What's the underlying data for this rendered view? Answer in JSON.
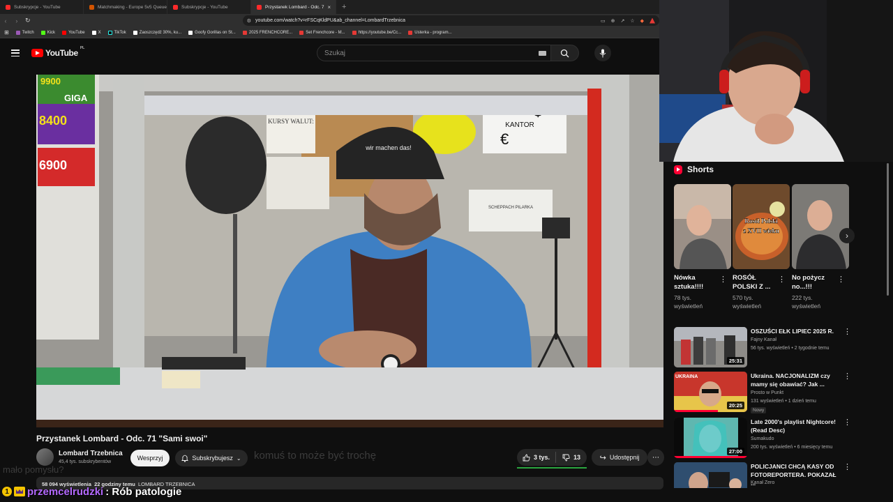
{
  "browser": {
    "tabs": [
      {
        "label": "Subskrypcje - YouTube",
        "active": false
      },
      {
        "label": "Matchmaking - Europe 5v5 Queue",
        "active": false
      },
      {
        "label": "Subskrypcje - YouTube",
        "active": false
      },
      {
        "label": "Przystanek Lombard - Odc. 7",
        "active": true
      }
    ],
    "url": "youtube.com/watch?v=rFSCqKldPU&ab_channel=LombardTrzebnica",
    "bookmarks": [
      "Twitch",
      "Kick",
      "YouTube",
      "X",
      "TikTok",
      "Zaoszczędź 30%, ku...",
      "Goofy Gorillas on St...",
      "2025 FRENCHCORE...",
      "Set Frenchcore - M...",
      "https://youtube.be/Cc...",
      "Usterka - program..."
    ]
  },
  "masthead": {
    "logo_text": "YouTube",
    "region": "PL",
    "search_placeholder": "Szukaj"
  },
  "video": {
    "title": "Przystanek Lombard - Odc. 71 \"Sami swoi\"",
    "channel_name": "Lombard Trzebnica",
    "channel_subs": "45,4 tys. subskrybentów",
    "support_label": "Wesprzyj",
    "subscribed_label": "Subskrybujesz",
    "likes": "3 tys.",
    "dislikes": "13",
    "share_label": "Udostępnij",
    "more_label": "⋯",
    "views": "58 094 wyświetlenia",
    "posted": "22 godziny temu",
    "channel_caps": "LOMBARD TRZEBNICA",
    "overlay_ghost_1": "komuś to może być trochę",
    "overlay_ghost_2": "mało pomysłu?"
  },
  "shorts": {
    "heading": "Shorts",
    "items": [
      {
        "title": "Nówka sztuka!!!!",
        "views": "78 tys. wyświetleń"
      },
      {
        "title": "ROSÓŁ POLSKI Z ...",
        "views": "570 tys. wyświetleń",
        "thumb_text_1": "Rosół Polski",
        "thumb_text_2": "z XVII wieku"
      },
      {
        "title": "No pożycz no...!!!",
        "views": "222 tys. wyświetleń"
      }
    ]
  },
  "recommendations": [
    {
      "title": "OSZUŚCI EŁK LIPIEC 2025 R.",
      "channel": "Fajny Kanał",
      "meta": "56 tys. wyświetleń • 2 tygodnie temu",
      "duration": "25:31",
      "badge": "",
      "thumb_text": ""
    },
    {
      "title": "Ukraina. NACJONALIZM czy mamy się obawiać? Jak ...",
      "channel": "Prosto w Punkt",
      "meta": "131 wyświetleń • 1 dzień temu",
      "duration": "20:25",
      "badge": "Nowy",
      "thumb_text": "UKRAINA"
    },
    {
      "title": "Late 2000's playlist Nightcore! (Read Desc)",
      "channel": "Sumakudo",
      "meta": "200 tys. wyświetleń • 6 miesięcy temu",
      "duration": "27:00",
      "badge": "",
      "thumb_text": ""
    },
    {
      "title": "POLICJANCI CHCĄ KASY OD FOTOREPORTERA. POKAZAŁ ...",
      "channel": "Kanał Zero",
      "meta": "",
      "duration": "",
      "badge": "",
      "thumb_text": ""
    }
  ],
  "video_scene": {
    "sign_kursy": "KURSY WALUT:",
    "sign_kantor": "KANTOR",
    "cap_text": "wir machen das!",
    "promo_1": "9900",
    "promo_2": "8400",
    "promo_3": "6900",
    "promo_giga": "GIGA",
    "poster_text": "SCHEPPACH PILARKA"
  },
  "chat": {
    "badge": "1",
    "user": "przemcelrudzki",
    "message": ": Rób patologie"
  },
  "colors": {
    "background": "#0f0f0f",
    "accent": "#ff0000",
    "like_bar": "#2ba640",
    "chat_user": "#b469ff"
  }
}
